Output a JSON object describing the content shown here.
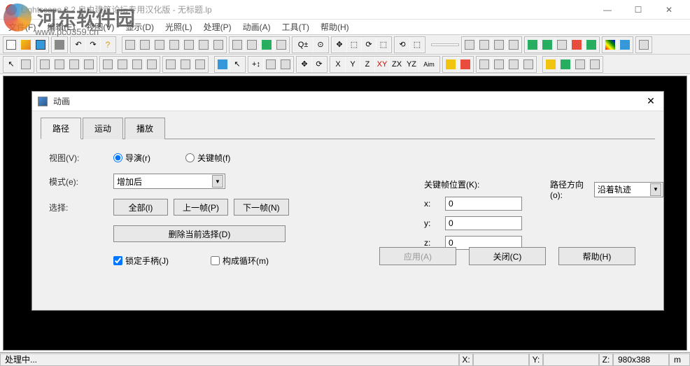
{
  "watermark": {
    "text": "河东软件园",
    "url": "www.pc0359.cn"
  },
  "titlebar": {
    "title": "Lightscape 3.2 自由建筑论坛专用汉化版  - 无标题.lp"
  },
  "window": {
    "minimize": "—",
    "maximize": "☐",
    "close": "✕"
  },
  "menubar": {
    "items": [
      "文件(F)",
      "编辑(E)",
      "视图(V)",
      "显示(D)",
      "光照(L)",
      "处理(P)",
      "动画(A)",
      "工具(T)",
      "帮助(H)"
    ]
  },
  "dialog": {
    "title": "动画",
    "tabs": [
      "路径",
      "运动",
      "播放"
    ],
    "active_tab": 0,
    "view_label": "视图(V):",
    "radio_director": "导演(r)",
    "radio_keyframe": "关键帧(f)",
    "mode_label": "模式(e):",
    "mode_value": "增加后",
    "select_label": "选择:",
    "btn_all": "全部(l)",
    "btn_prev": "上一帧(P)",
    "btn_next": "下一帧(N)",
    "btn_delete": "删除当前选择(D)",
    "kf_pos_label": "关键帧位置(K):",
    "x_label": "x:",
    "y_label": "y:",
    "z_label": "z:",
    "x_value": "0",
    "y_value": "0",
    "z_value": "0",
    "path_dir_label": "路径方向(o):",
    "path_dir_value": "沿着轨迹",
    "chk_lock": "锁定手柄(J)",
    "chk_loop": "构成循环(m)",
    "btn_apply": "应用(A)",
    "btn_close": "关闭(C)",
    "btn_help": "帮助(H)"
  },
  "statusbar": {
    "status": "处理中...",
    "x_label": "X:",
    "y_label": "Y:",
    "z_label": "Z:",
    "z_value": "980x388",
    "unit": "m"
  },
  "toolbar2_labels": {
    "x": "X",
    "y": "Y",
    "z": "Z",
    "xy": "XY",
    "zx": "ZX",
    "yz": "YZ",
    "aim": "Aim"
  }
}
